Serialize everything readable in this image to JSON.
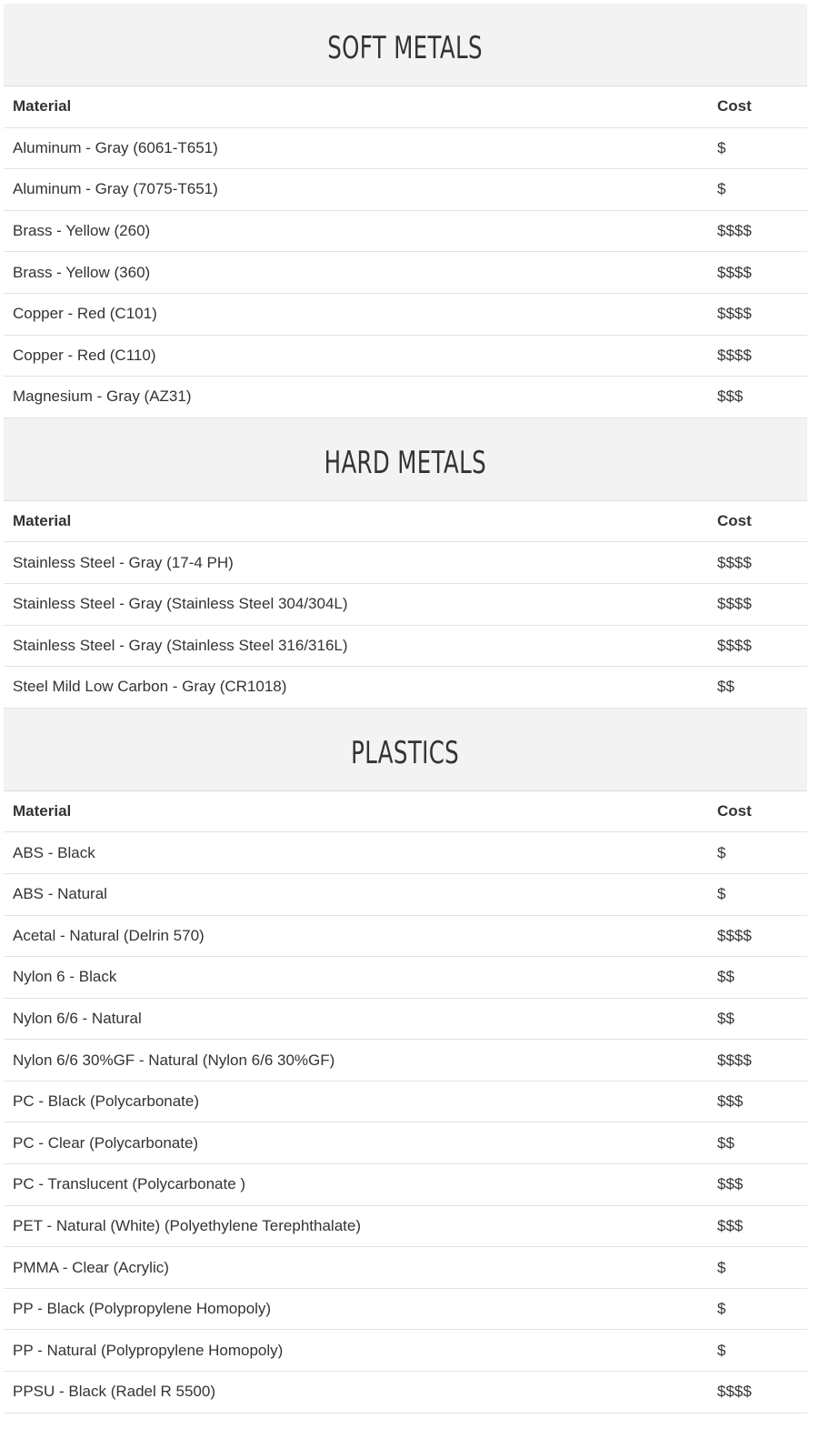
{
  "columns": {
    "material": "Material",
    "cost": "Cost"
  },
  "sections": [
    {
      "title": "SOFT METALS",
      "rows": [
        {
          "material": "Aluminum - Gray (6061-T651)",
          "cost": "$"
        },
        {
          "material": "Aluminum - Gray (7075-T651)",
          "cost": "$"
        },
        {
          "material": "Brass - Yellow (260)",
          "cost": "$$$$"
        },
        {
          "material": "Brass - Yellow (360)",
          "cost": "$$$$"
        },
        {
          "material": "Copper - Red (C101)",
          "cost": "$$$$"
        },
        {
          "material": "Copper - Red (C110)",
          "cost": "$$$$"
        },
        {
          "material": "Magnesium - Gray (AZ31)",
          "cost": "$$$"
        }
      ]
    },
    {
      "title": "HARD METALS",
      "rows": [
        {
          "material": "Stainless Steel - Gray (17-4 PH)",
          "cost": "$$$$"
        },
        {
          "material": "Stainless Steel - Gray (Stainless Steel 304/304L)",
          "cost": "$$$$"
        },
        {
          "material": "Stainless Steel - Gray (Stainless Steel 316/316L)",
          "cost": "$$$$"
        },
        {
          "material": "Steel Mild Low Carbon - Gray (CR1018)",
          "cost": "$$"
        }
      ]
    },
    {
      "title": "PLASTICS",
      "rows": [
        {
          "material": "ABS - Black",
          "cost": "$"
        },
        {
          "material": "ABS - Natural",
          "cost": "$"
        },
        {
          "material": "Acetal - Natural (Delrin 570)",
          "cost": "$$$$"
        },
        {
          "material": "Nylon 6 - Black",
          "cost": "$$"
        },
        {
          "material": "Nylon 6/6 - Natural",
          "cost": "$$"
        },
        {
          "material": "Nylon 6/6 30%GF - Natural (Nylon 6/6 30%GF)",
          "cost": "$$$$"
        },
        {
          "material": "PC - Black (Polycarbonate)",
          "cost": "$$$"
        },
        {
          "material": "PC - Clear (Polycarbonate)",
          "cost": "$$"
        },
        {
          "material": "PC - Translucent (Polycarbonate )",
          "cost": "$$$"
        },
        {
          "material": "PET - Natural (White) (Polyethylene Terephthalate)",
          "cost": "$$$"
        },
        {
          "material": "PMMA - Clear (Acrylic)",
          "cost": "$"
        },
        {
          "material": "PP - Black (Polypropylene Homopoly)",
          "cost": "$"
        },
        {
          "material": "PP - Natural (Polypropylene Homopoly)",
          "cost": "$"
        },
        {
          "material": "PPSU - Black (Radel R 5500)",
          "cost": "$$$$"
        }
      ]
    }
  ]
}
